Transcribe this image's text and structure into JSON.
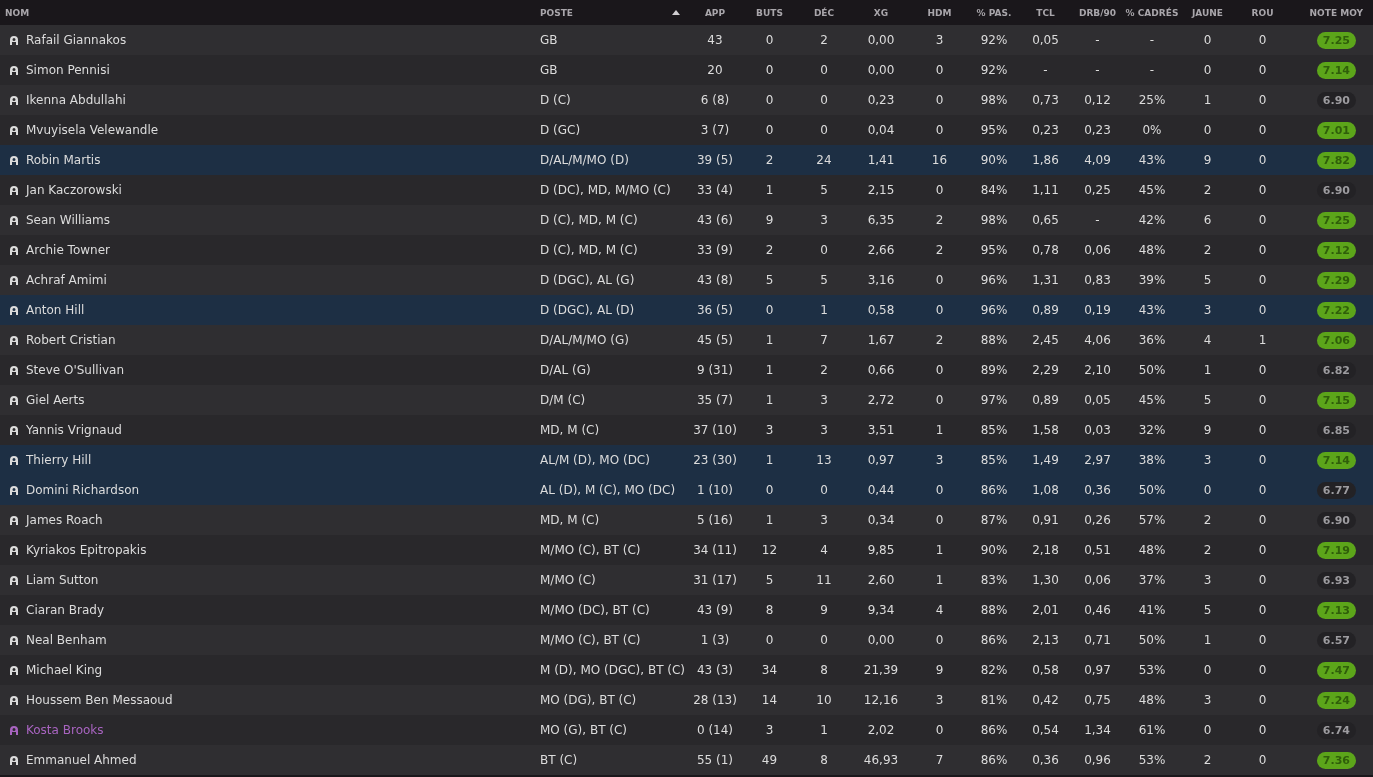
{
  "table": {
    "columns": [
      {
        "label": "NOM",
        "sorted": false
      },
      {
        "label": "POSTE",
        "sorted": true
      },
      {
        "label": "APP",
        "sorted": false
      },
      {
        "label": "BUTS",
        "sorted": false
      },
      {
        "label": "DÉC",
        "sorted": false
      },
      {
        "label": "XG",
        "sorted": false
      },
      {
        "label": "HDM",
        "sorted": false
      },
      {
        "label": "% PAS.",
        "sorted": false
      },
      {
        "label": "TCL",
        "sorted": false
      },
      {
        "label": "DRB/90",
        "sorted": false
      },
      {
        "label": "% CADRÉS",
        "sorted": false
      },
      {
        "label": "JAUNE",
        "sorted": false
      },
      {
        "label": "ROU",
        "sorted": false
      },
      {
        "label": "NOTE MOY",
        "sorted": false
      }
    ],
    "rows": [
      {
        "name": "Rafail Giannakos",
        "position": "GB",
        "stats": [
          "43",
          "0",
          "2",
          "0,00",
          "3",
          "92%",
          "0,05",
          "-",
          "-",
          "0",
          "0"
        ],
        "rating": "7.25",
        "good": true,
        "selected": false,
        "color": "#dcdcdc"
      },
      {
        "name": "Simon Pennisi",
        "position": "GB",
        "stats": [
          "20",
          "0",
          "0",
          "0,00",
          "0",
          "92%",
          "-",
          "-",
          "-",
          "0",
          "0"
        ],
        "rating": "7.14",
        "good": true,
        "selected": false,
        "color": "#dcdcdc"
      },
      {
        "name": "Ikenna Abdullahi",
        "position": "D (C)",
        "stats": [
          "6 (8)",
          "0",
          "0",
          "0,23",
          "0",
          "98%",
          "0,73",
          "0,12",
          "25%",
          "1",
          "0"
        ],
        "rating": "6.90",
        "good": false,
        "selected": false,
        "color": "#dcdcdc"
      },
      {
        "name": "Mvuyisela Velewandle",
        "position": "D (GC)",
        "stats": [
          "3 (7)",
          "0",
          "0",
          "0,04",
          "0",
          "95%",
          "0,23",
          "0,23",
          "0%",
          "0",
          "0"
        ],
        "rating": "7.01",
        "good": true,
        "selected": false,
        "color": "#dcdcdc"
      },
      {
        "name": "Robin Martis",
        "position": "D/AL/M/MO (D)",
        "stats": [
          "39 (5)",
          "2",
          "24",
          "1,41",
          "16",
          "90%",
          "1,86",
          "4,09",
          "43%",
          "9",
          "0"
        ],
        "rating": "7.82",
        "good": true,
        "selected": true,
        "color": "#dcdcdc"
      },
      {
        "name": "Jan Kaczorowski",
        "position": "D (DC), MD, M/MO (C)",
        "stats": [
          "33 (4)",
          "1",
          "5",
          "2,15",
          "0",
          "84%",
          "1,11",
          "0,25",
          "45%",
          "2",
          "0"
        ],
        "rating": "6.90",
        "good": false,
        "selected": false,
        "color": "#dcdcdc"
      },
      {
        "name": "Sean Williams",
        "position": "D (C), MD, M (C)",
        "stats": [
          "43 (6)",
          "9",
          "3",
          "6,35",
          "2",
          "98%",
          "0,65",
          "-",
          "42%",
          "6",
          "0"
        ],
        "rating": "7.25",
        "good": true,
        "selected": false,
        "color": "#dcdcdc"
      },
      {
        "name": "Archie Towner",
        "position": "D (C), MD, M (C)",
        "stats": [
          "33 (9)",
          "2",
          "0",
          "2,66",
          "2",
          "95%",
          "0,78",
          "0,06",
          "48%",
          "2",
          "0"
        ],
        "rating": "7.12",
        "good": true,
        "selected": false,
        "color": "#dcdcdc"
      },
      {
        "name": "Achraf Amimi",
        "position": "D (DGC), AL (G)",
        "stats": [
          "43 (8)",
          "5",
          "5",
          "3,16",
          "0",
          "96%",
          "1,31",
          "0,83",
          "39%",
          "5",
          "0"
        ],
        "rating": "7.29",
        "good": true,
        "selected": false,
        "color": "#dcdcdc"
      },
      {
        "name": "Anton Hill",
        "position": "D (DGC), AL (D)",
        "stats": [
          "36 (5)",
          "0",
          "1",
          "0,58",
          "0",
          "96%",
          "0,89",
          "0,19",
          "43%",
          "3",
          "0"
        ],
        "rating": "7.22",
        "good": true,
        "selected": true,
        "color": "#dcdcdc"
      },
      {
        "name": "Robert Cristian",
        "position": "D/AL/M/MO (G)",
        "stats": [
          "45 (5)",
          "1",
          "7",
          "1,67",
          "2",
          "88%",
          "2,45",
          "4,06",
          "36%",
          "4",
          "1"
        ],
        "rating": "7.06",
        "good": true,
        "selected": false,
        "color": "#dcdcdc"
      },
      {
        "name": "Steve O'Sullivan",
        "position": "D/AL (G)",
        "stats": [
          "9 (31)",
          "1",
          "2",
          "0,66",
          "0",
          "89%",
          "2,29",
          "2,10",
          "50%",
          "1",
          "0"
        ],
        "rating": "6.82",
        "good": false,
        "selected": false,
        "color": "#dcdcdc"
      },
      {
        "name": "Giel Aerts",
        "position": "D/M (C)",
        "stats": [
          "35 (7)",
          "1",
          "3",
          "2,72",
          "0",
          "97%",
          "0,89",
          "0,05",
          "45%",
          "5",
          "0"
        ],
        "rating": "7.15",
        "good": true,
        "selected": false,
        "color": "#dcdcdc"
      },
      {
        "name": "Yannis Vrignaud",
        "position": "MD, M (C)",
        "stats": [
          "37 (10)",
          "3",
          "3",
          "3,51",
          "1",
          "85%",
          "1,58",
          "0,03",
          "32%",
          "9",
          "0"
        ],
        "rating": "6.85",
        "good": false,
        "selected": false,
        "color": "#dcdcdc"
      },
      {
        "name": "Thierry Hill",
        "position": "AL/M (D), MO (DC)",
        "stats": [
          "23 (30)",
          "1",
          "13",
          "0,97",
          "3",
          "85%",
          "1,49",
          "2,97",
          "38%",
          "3",
          "0"
        ],
        "rating": "7.14",
        "good": true,
        "selected": true,
        "color": "#dcdcdc"
      },
      {
        "name": "Domini Richardson",
        "position": "AL (D), M (C), MO (DC)",
        "stats": [
          "1 (10)",
          "0",
          "0",
          "0,44",
          "0",
          "86%",
          "1,08",
          "0,36",
          "50%",
          "0",
          "0"
        ],
        "rating": "6.77",
        "good": false,
        "selected": true,
        "color": "#dcdcdc"
      },
      {
        "name": "James Roach",
        "position": "MD, M (C)",
        "stats": [
          "5 (16)",
          "1",
          "3",
          "0,34",
          "0",
          "87%",
          "0,91",
          "0,26",
          "57%",
          "2",
          "0"
        ],
        "rating": "6.90",
        "good": false,
        "selected": false,
        "color": "#dcdcdc"
      },
      {
        "name": "Kyriakos Epitropakis",
        "position": "M/MO (C), BT (C)",
        "stats": [
          "34 (11)",
          "12",
          "4",
          "9,85",
          "1",
          "90%",
          "2,18",
          "0,51",
          "48%",
          "2",
          "0"
        ],
        "rating": "7.19",
        "good": true,
        "selected": false,
        "color": "#dcdcdc"
      },
      {
        "name": "Liam Sutton",
        "position": "M/MO (C)",
        "stats": [
          "31 (17)",
          "5",
          "11",
          "2,60",
          "1",
          "83%",
          "1,30",
          "0,06",
          "37%",
          "3",
          "0"
        ],
        "rating": "6.93",
        "good": false,
        "selected": false,
        "color": "#dcdcdc"
      },
      {
        "name": "Ciaran Brady",
        "position": "M/MO (DC), BT (C)",
        "stats": [
          "43 (9)",
          "8",
          "9",
          "9,34",
          "4",
          "88%",
          "2,01",
          "0,46",
          "41%",
          "5",
          "0"
        ],
        "rating": "7.13",
        "good": true,
        "selected": false,
        "color": "#dcdcdc"
      },
      {
        "name": "Neal Benham",
        "position": "M/MO (C), BT (C)",
        "stats": [
          "1 (3)",
          "0",
          "0",
          "0,00",
          "0",
          "86%",
          "2,13",
          "0,71",
          "50%",
          "1",
          "0"
        ],
        "rating": "6.57",
        "good": false,
        "selected": false,
        "color": "#dcdcdc"
      },
      {
        "name": "Michael King",
        "position": "M (D), MO (DGC), BT (C)",
        "stats": [
          "43 (3)",
          "34",
          "8",
          "21,39",
          "9",
          "82%",
          "0,58",
          "0,97",
          "53%",
          "0",
          "0"
        ],
        "rating": "7.47",
        "good": true,
        "selected": false,
        "color": "#dcdcdc"
      },
      {
        "name": "Houssem Ben Messaoud",
        "position": "MO (DG), BT (C)",
        "stats": [
          "28 (13)",
          "14",
          "10",
          "12,16",
          "3",
          "81%",
          "0,42",
          "0,75",
          "48%",
          "3",
          "0"
        ],
        "rating": "7.24",
        "good": true,
        "selected": false,
        "color": "#dcdcdc"
      },
      {
        "name": "Kosta Brooks",
        "position": "MO (G), BT (C)",
        "stats": [
          "0 (14)",
          "3",
          "1",
          "2,02",
          "0",
          "86%",
          "0,54",
          "1,34",
          "61%",
          "0",
          "0"
        ],
        "rating": "6.74",
        "good": false,
        "selected": false,
        "color": "#a864c0"
      },
      {
        "name": "Emmanuel Ahmed",
        "position": "BT (C)",
        "stats": [
          "55 (1)",
          "49",
          "8",
          "46,93",
          "7",
          "86%",
          "0,36",
          "0,96",
          "53%",
          "2",
          "0"
        ],
        "rating": "7.36",
        "good": true,
        "selected": false,
        "color": "#dcdcdc"
      }
    ]
  }
}
